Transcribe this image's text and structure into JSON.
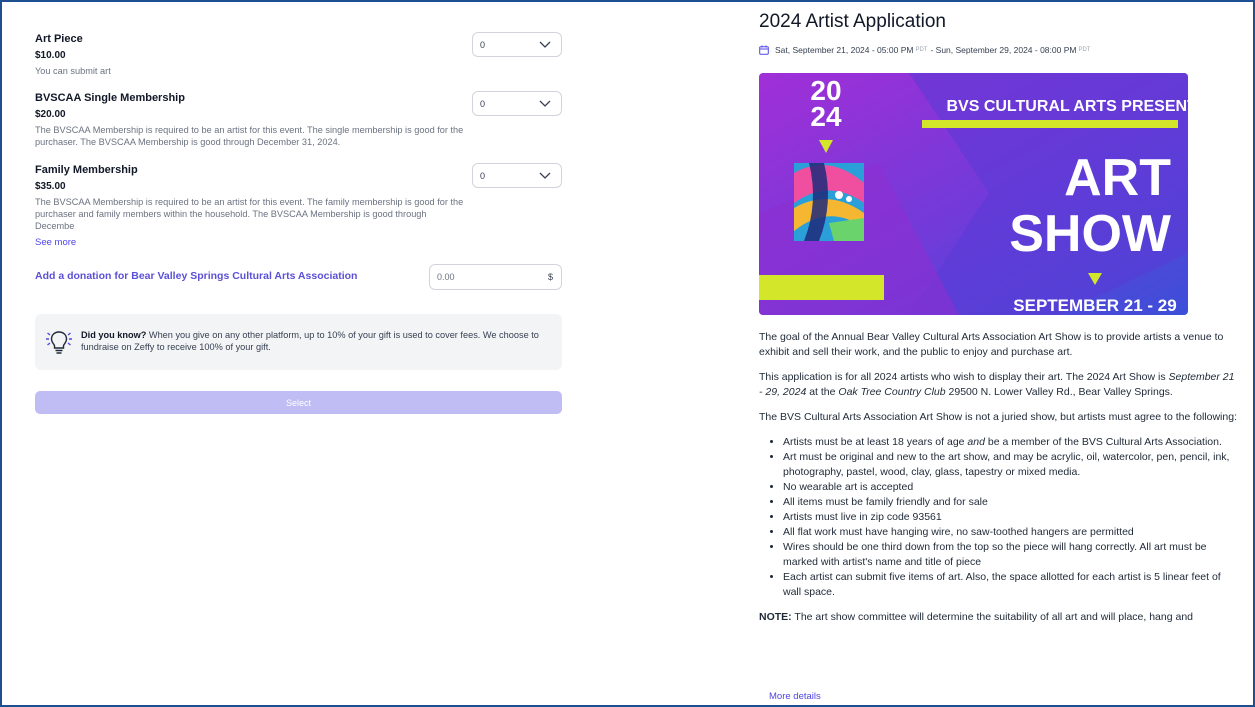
{
  "tickets": [
    {
      "name": "Art Piece",
      "price": "$10.00",
      "description": "You can submit art",
      "quantity": "0"
    },
    {
      "name": "BVSCAA Single Membership",
      "price": "$20.00",
      "description": "The BVSCAA Membership is required to be an artist for this event. The single membership is good for the purchaser. The BVSCAA Membership is good through December 31, 2024.",
      "quantity": "0"
    },
    {
      "name": "Family Membership",
      "price": "$35.00",
      "description": "The BVSCAA Membership is required to be an artist for this event. The family membership is good for the purchaser and family members within the household. The BVSCAA Membership is good through Decembe",
      "quantity": "0",
      "see_more": "See more"
    }
  ],
  "donation": {
    "label": "Add a donation for Bear Valley Springs Cultural Arts Association",
    "placeholder": "0.00",
    "currency": "$"
  },
  "tip": {
    "bold": "Did you know?",
    "text": " When you give on any other platform, up to 10% of your gift is used to cover fees. We choose to fundraise on Zeffy to receive 100% of your gift."
  },
  "select_button": "Select",
  "event": {
    "title": "2024 Artist Application",
    "start": "Sat, September 21, 2024 - 05:00 PM",
    "start_tz": "PDT",
    "separator": "- Sun, September 29, 2024 - 08:00 PM",
    "end_tz": "PDT",
    "banner": {
      "year_top": "20",
      "year_bottom": "24",
      "presents": "BVS CULTURAL ARTS PRESENTS",
      "line1": "ART",
      "line2": "SHOW",
      "dates": "SEPTEMBER 21 - 29"
    },
    "intro": "The goal of the Annual Bear Valley Cultural Arts Association Art Show is to provide artists a venue to exhibit and sell their work, and the public to enjoy and purchase art.",
    "para2_a": "This application is for all 2024 artists who wish to display their art. The 2024 Art Show is ",
    "para2_dates": "September 21 - 29, 2024",
    "para2_b": " at the ",
    "para2_venue": "Oak Tree Country Club",
    "para2_c": " 29500 N. Lower Valley Rd., Bear Valley Springs.",
    "para3": "The BVS Cultural Arts Association Art Show is not a juried show, but artists must agree to the following:",
    "rule1_a": "Artists must be at least 18 years of age ",
    "rule1_em": "and",
    "rule1_b": " be a member of the BVS Cultural Arts Association.",
    "rules": [
      "Art must be original and new to the art show, and may be acrylic, oil, watercolor, pen, pencil, ink, photography, pastel, wood, clay, glass, tapestry or mixed media.",
      "No wearable art is accepted",
      "All items must be family friendly and for sale",
      "Artists must live in zip code 93561",
      "All flat work must have hanging wire, no saw-toothed hangers are permitted",
      "Wires should be one third down from the top so the piece will hang correctly. All art must be marked with artist's name and title of piece",
      "Each artist can submit five items of art. Also, the space allotted for each artist is 5 linear feet of wall space."
    ],
    "note_label": "NOTE:",
    "note": " The art show committee will determine the suitability of all art and will place, hang and",
    "more_details": "More details"
  },
  "colors": {
    "accent": "#5b50d6",
    "select_disabled": "#c0bdf5",
    "banner_purple": "#8a2be2",
    "banner_lime": "#d4e62a",
    "frame": "#1d4f91"
  }
}
